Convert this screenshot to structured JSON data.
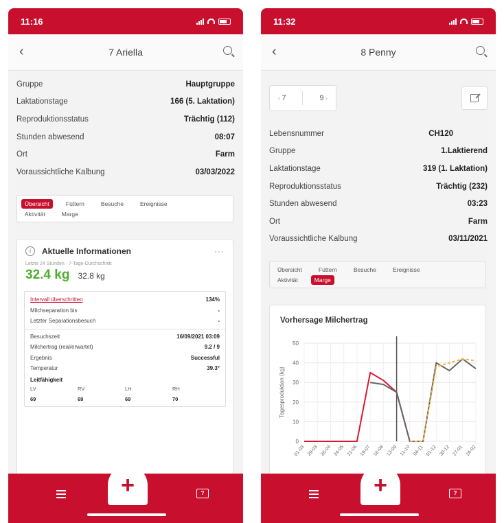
{
  "left": {
    "status": {
      "time": "11:16"
    },
    "nav": {
      "title": "7 Ariella"
    },
    "info": [
      {
        "label": "Gruppe",
        "value": "Hauptgruppe"
      },
      {
        "label": "Laktationstage",
        "value": "166 (5. Laktation)"
      },
      {
        "label": "Reproduktionsstatus",
        "value": "Trächtig (112)"
      },
      {
        "label": "Stunden abwesend",
        "value": "08:07"
      },
      {
        "label": "Ort",
        "value": "Farm"
      },
      {
        "label": "Voraussichtliche Kalbung",
        "value": "03/03/2022"
      }
    ],
    "tabs": {
      "row1": [
        "Übersicht",
        "Füttern",
        "Besuche",
        "Ereignisse"
      ],
      "row2": [
        "Aktivität",
        "Marge"
      ],
      "active": "Übersicht"
    },
    "card": {
      "title": "Aktuelle Informationen",
      "dots": "···",
      "subtitle": "Letzte 24 Stunden · 7-Tage-Durchschnitt",
      "value_main": "32.4 kg",
      "value_second": "32.8 kg",
      "details_top": [
        {
          "label": "Intervall überschritten",
          "value": "134%"
        },
        {
          "label": "Milchseparation bis",
          "value": "-"
        },
        {
          "label": "Letzter Separationsbesuch",
          "value": "-"
        }
      ],
      "details_bottom": [
        {
          "label": "Besuchszeit",
          "value": "16/09/2021 03:09"
        },
        {
          "label": "Milchertrag (real/erwartet)",
          "value": "9.2 / 9"
        },
        {
          "label": "Ergebnis",
          "value": "Successful"
        },
        {
          "label": "Temperatur",
          "value": "39.3°"
        }
      ],
      "lf_title": "Leitfähigkeit",
      "lf_headers": [
        "LV",
        "RV",
        "LH",
        "RH"
      ],
      "lf_values": [
        "69",
        "69",
        "69",
        "70"
      ]
    }
  },
  "right": {
    "status": {
      "time": "11:32"
    },
    "nav": {
      "title": "8 Penny"
    },
    "pager": {
      "prev": "7",
      "next": "9"
    },
    "info": [
      {
        "label": "Lebensnummer",
        "value": "CH120"
      },
      {
        "label": "Gruppe",
        "value": "1.Laktierend"
      },
      {
        "label": "Laktationstage",
        "value": "319 (1. Laktation)"
      },
      {
        "label": "Reproduktionsstatus",
        "value": "Trächtig (232)"
      },
      {
        "label": "Stunden abwesend",
        "value": "03:23"
      },
      {
        "label": "Ort",
        "value": "Farm"
      },
      {
        "label": "Voraussichtliche Kalbung",
        "value": "03/11/2021"
      }
    ],
    "tabs": {
      "row1": [
        "Übersicht",
        "Füttern",
        "Besuche",
        "Ereignisse"
      ],
      "row2": [
        "Aktivität",
        "Marge"
      ],
      "active": "Marge"
    }
  },
  "bottom_bar": {
    "plus": "+",
    "chat": "?"
  },
  "colors": {
    "brand": "#c8102e",
    "green": "#4cae31",
    "actual_line": "#666666",
    "forecast_line": "#f2b43c"
  },
  "chart_data": {
    "type": "line",
    "title": "Vorhersage Milchertrag",
    "ylabel": "Tagesproduktion (kg)",
    "xlabel": "",
    "ylim": [
      0,
      50
    ],
    "yticks": [
      0,
      10,
      20,
      30,
      40,
      50
    ],
    "x": [
      "01-03",
      "29-03",
      "26-04",
      "24-05",
      "21-06",
      "19-07",
      "16-08",
      "13-09",
      "11-10",
      "04-11",
      "01-12",
      "30-12",
      "27-01",
      "24-02"
    ],
    "series": [
      {
        "values": [
          0,
          0,
          0,
          0,
          0,
          35,
          31,
          25,
          0,
          0,
          null,
          null,
          null,
          null
        ],
        "color": "#d8192e"
      },
      {
        "values": [
          null,
          null,
          null,
          null,
          null,
          30,
          29,
          25,
          0,
          0,
          40,
          36,
          42,
          37
        ],
        "color": "#666666"
      },
      {
        "values": [
          null,
          null,
          null,
          null,
          null,
          null,
          null,
          null,
          0,
          0,
          38,
          40,
          42,
          41
        ],
        "color": "#f2b43c",
        "dashed": true
      }
    ],
    "marker_x": "13-09"
  }
}
